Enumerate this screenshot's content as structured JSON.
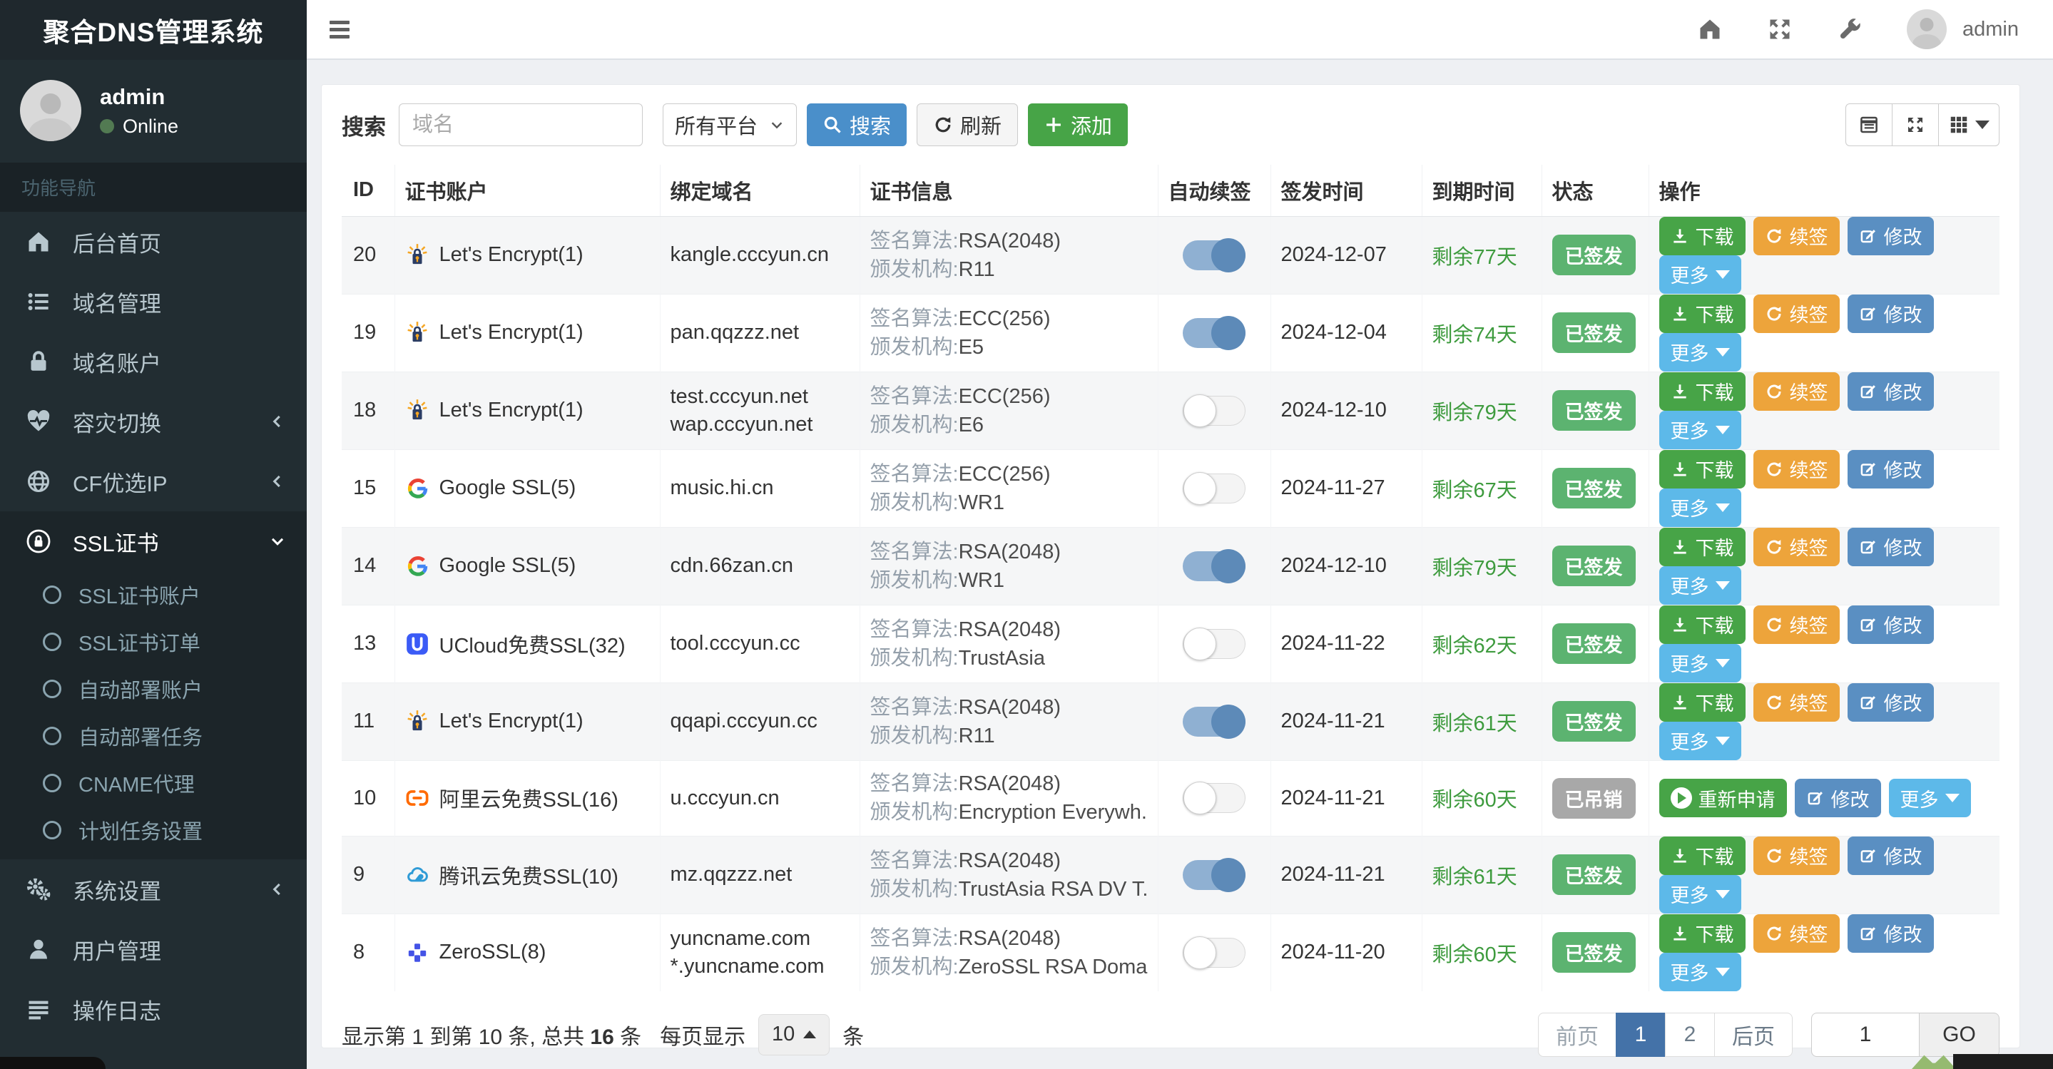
{
  "sidebar": {
    "logo": "聚合DNS管理系统",
    "user": {
      "name": "admin",
      "status": "Online"
    },
    "nav_label": "功能导航",
    "menu": [
      {
        "key": "home",
        "icon": "home",
        "label": "后台首页"
      },
      {
        "key": "domain-manage",
        "icon": "list",
        "label": "域名管理"
      },
      {
        "key": "domain-accounts",
        "icon": "lock",
        "label": "域名账户"
      },
      {
        "key": "failover",
        "icon": "heartbeat",
        "label": "容灾切换",
        "arrow": "left"
      },
      {
        "key": "cf-ip",
        "icon": "globe",
        "label": "CF优选IP",
        "arrow": "left"
      },
      {
        "key": "ssl-cert",
        "icon": "ssl",
        "label": "SSL证书",
        "arrow": "down",
        "active": true,
        "submenu": [
          {
            "key": "ssl-accounts",
            "label": "SSL证书账户"
          },
          {
            "key": "ssl-orders",
            "label": "SSL证书订单"
          },
          {
            "key": "deploy-accounts",
            "label": "自动部署账户"
          },
          {
            "key": "deploy-tasks",
            "label": "自动部署任务"
          },
          {
            "key": "cname-proxy",
            "label": "CNAME代理"
          },
          {
            "key": "cron-settings",
            "label": "计划任务设置"
          }
        ]
      },
      {
        "key": "system-settings",
        "icon": "gears",
        "label": "系统设置",
        "arrow": "left"
      },
      {
        "key": "user-manage",
        "icon": "user",
        "label": "用户管理"
      },
      {
        "key": "operation-logs",
        "icon": "list-alt",
        "label": "操作日志"
      }
    ]
  },
  "topbar": {
    "user": "admin"
  },
  "toolbar": {
    "search_label": "搜索",
    "search_placeholder": "域名",
    "platform_select": "所有平台",
    "search_btn": "搜索",
    "refresh_btn": "刷新",
    "add_btn": "添加"
  },
  "table": {
    "headers": [
      "ID",
      "证书账户",
      "绑定域名",
      "证书信息",
      "自动续签",
      "签发时间",
      "到期时间",
      "状态",
      "操作"
    ],
    "cert_labels": {
      "algo": "签名算法:",
      "issuer": "颁发机构:"
    },
    "action_labels": {
      "download": "下载",
      "renew": "续签",
      "edit": "修改",
      "more": "更多",
      "reapply": "重新申请"
    },
    "rows": [
      {
        "id": "20",
        "provider": "letsencrypt",
        "account": "Let's Encrypt(1)",
        "domains": [
          "kangle.cccyun.cn"
        ],
        "algorithm": "RSA(2048)",
        "issuer": "R11",
        "auto_renew": true,
        "issued_date": "2024-12-07",
        "expires": "剩余77天",
        "status": "已签发",
        "status_type": "issued"
      },
      {
        "id": "19",
        "provider": "letsencrypt",
        "account": "Let's Encrypt(1)",
        "domains": [
          "pan.qqzzz.net"
        ],
        "algorithm": "ECC(256)",
        "issuer": "E5",
        "auto_renew": true,
        "issued_date": "2024-12-04",
        "expires": "剩余74天",
        "status": "已签发",
        "status_type": "issued"
      },
      {
        "id": "18",
        "provider": "letsencrypt",
        "account": "Let's Encrypt(1)",
        "domains": [
          "test.cccyun.net",
          "wap.cccyun.net"
        ],
        "algorithm": "ECC(256)",
        "issuer": "E6",
        "auto_renew": false,
        "issued_date": "2024-12-10",
        "expires": "剩余79天",
        "status": "已签发",
        "status_type": "issued"
      },
      {
        "id": "15",
        "provider": "google",
        "account": "Google SSL(5)",
        "domains": [
          "music.hi.cn"
        ],
        "algorithm": "ECC(256)",
        "issuer": "WR1",
        "auto_renew": false,
        "issued_date": "2024-11-27",
        "expires": "剩余67天",
        "status": "已签发",
        "status_type": "issued"
      },
      {
        "id": "14",
        "provider": "google",
        "account": "Google SSL(5)",
        "domains": [
          "cdn.66zan.cn"
        ],
        "algorithm": "RSA(2048)",
        "issuer": "WR1",
        "auto_renew": true,
        "issued_date": "2024-12-10",
        "expires": "剩余79天",
        "status": "已签发",
        "status_type": "issued"
      },
      {
        "id": "13",
        "provider": "ucloud",
        "account": "UCloud免费SSL(32)",
        "domains": [
          "tool.cccyun.cc"
        ],
        "algorithm": "RSA(2048)",
        "issuer": "TrustAsia",
        "auto_renew": false,
        "issued_date": "2024-11-22",
        "expires": "剩余62天",
        "status": "已签发",
        "status_type": "issued"
      },
      {
        "id": "11",
        "provider": "letsencrypt",
        "account": "Let's Encrypt(1)",
        "domains": [
          "qqapi.cccyun.cc"
        ],
        "algorithm": "RSA(2048)",
        "issuer": "R11",
        "auto_renew": true,
        "issued_date": "2024-11-21",
        "expires": "剩余61天",
        "status": "已签发",
        "status_type": "issued"
      },
      {
        "id": "10",
        "provider": "aliyun",
        "account": "阿里云免费SSL(16)",
        "domains": [
          "u.cccyun.cn"
        ],
        "algorithm": "RSA(2048)",
        "issuer": "Encryption Everywh...",
        "auto_renew": false,
        "issued_date": "2024-11-21",
        "expires": "剩余60天",
        "status": "已吊销",
        "status_type": "revoked"
      },
      {
        "id": "9",
        "provider": "tencent",
        "account": "腾讯云免费SSL(10)",
        "domains": [
          "mz.qqzzz.net"
        ],
        "algorithm": "RSA(2048)",
        "issuer": "TrustAsia RSA DV T...",
        "auto_renew": true,
        "issued_date": "2024-11-21",
        "expires": "剩余61天",
        "status": "已签发",
        "status_type": "issued"
      },
      {
        "id": "8",
        "provider": "zerossl",
        "account": "ZeroSSL(8)",
        "domains": [
          "yuncname.com",
          "*.yuncname.com"
        ],
        "algorithm": "RSA(2048)",
        "issuer": "ZeroSSL RSA Doma...",
        "auto_renew": false,
        "issued_date": "2024-11-20",
        "expires": "剩余60天",
        "status": "已签发",
        "status_type": "issued"
      }
    ]
  },
  "footer": {
    "summary_prefix": "显示第 1 到第 10 条, 总共",
    "summary_total": "16",
    "summary_suffix": "条",
    "per_page_label": "每页显示",
    "per_page_value": "10",
    "per_page_suffix": "条"
  },
  "pagination": {
    "prev": "前页",
    "pages": [
      "1",
      "2"
    ],
    "active_page": "1",
    "next": "后页",
    "jump_value": "1",
    "go_label": "GO"
  },
  "colors": {
    "sidebar_bg": "#222d32",
    "accent_blue": "#4a8fca",
    "button_green": "#47a447",
    "button_orange": "#eda43b",
    "button_steel_blue": "#5a8fc2",
    "button_light_blue": "#5db9e9",
    "badge_green": "#5cb370",
    "badge_gray": "#a8a8a8",
    "remaining_green": "#3e9b3e",
    "active_page_blue": "#4472a8"
  }
}
